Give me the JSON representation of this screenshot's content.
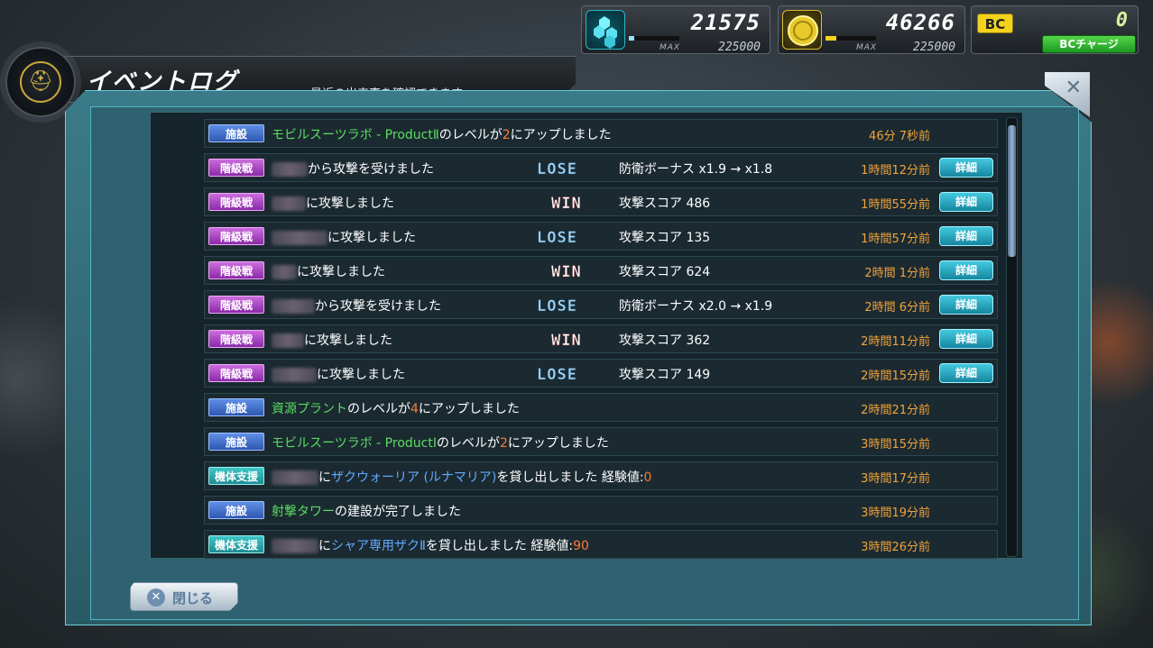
{
  "resources": {
    "parts": {
      "icon": "hex-parts-icon",
      "value": "21575",
      "max_label": "MAX",
      "max": "225000",
      "fill": 0.1
    },
    "coin": {
      "icon": "coin-icon",
      "value": "46266",
      "max_label": "MAX",
      "max": "225000",
      "fill": 0.21
    },
    "bc": {
      "badge": "BC",
      "value": "0",
      "charge_label": "BCチャージ"
    }
  },
  "header": {
    "title": "イベントログ",
    "subtitle": "最近の出来事を確認できます"
  },
  "rows": [
    {
      "cat": "施設",
      "cat_type": "facility",
      "pre": "モビルスーツラボ - ProductⅡ",
      "pre_class": "hl-green",
      "mid": "のレベルが",
      "num": "2",
      "post": "にアップしました",
      "time": "46分 7秒前"
    },
    {
      "cat": "階級戦",
      "cat_type": "rank",
      "blur": 40,
      "text": "から攻撃を受けました",
      "result": "LOSE",
      "bonus": "防衛ボーナス x1.9 → x1.8",
      "time": "1時間12分前",
      "detail": "詳細"
    },
    {
      "cat": "階級戦",
      "cat_type": "rank",
      "blur": 38,
      "text": "に攻撃しました",
      "result": "WIN",
      "bonus": "攻撃スコア 486",
      "time": "1時間55分前",
      "detail": "詳細"
    },
    {
      "cat": "階級戦",
      "cat_type": "rank",
      "blur": 62,
      "text": "に攻撃しました",
      "result": "LOSE",
      "bonus": "攻撃スコア 135",
      "time": "1時間57分前",
      "detail": "詳細"
    },
    {
      "cat": "階級戦",
      "cat_type": "rank",
      "blur": 28,
      "text": "に攻撃しました",
      "result": "WIN",
      "bonus": "攻撃スコア 624",
      "time": "2時間 1分前",
      "detail": "詳細"
    },
    {
      "cat": "階級戦",
      "cat_type": "rank",
      "blur": 48,
      "text": "から攻撃を受けました",
      "result": "LOSE",
      "bonus": "防衛ボーナス x2.0 → x1.9",
      "time": "2時間 6分前",
      "detail": "詳細"
    },
    {
      "cat": "階級戦",
      "cat_type": "rank",
      "blur": 36,
      "text": "に攻撃しました",
      "result": "WIN",
      "bonus": "攻撃スコア 362",
      "time": "2時間11分前",
      "detail": "詳細"
    },
    {
      "cat": "階級戦",
      "cat_type": "rank",
      "blur": 50,
      "text": "に攻撃しました",
      "result": "LOSE",
      "bonus": "攻撃スコア 149",
      "time": "2時間15分前",
      "detail": "詳細"
    },
    {
      "cat": "施設",
      "cat_type": "facility",
      "pre": "資源プラント",
      "pre_class": "hl-green",
      "mid": "のレベルが",
      "num": "4",
      "post": "にアップしました",
      "time": "2時間21分前"
    },
    {
      "cat": "施設",
      "cat_type": "facility",
      "pre": "モビルスーツラボ - ProductⅠ",
      "pre_class": "hl-green",
      "mid": "のレベルが",
      "num": "2",
      "post": "にアップしました",
      "time": "3時間15分前"
    },
    {
      "cat": "機体支援",
      "cat_type": "support",
      "blur": 52,
      "mid": "に",
      "unit": "ザクウォーリア (ルナマリア)",
      "post": "を貸し出しました 経験値:",
      "exp": "0",
      "time": "3時間17分前"
    },
    {
      "cat": "施設",
      "cat_type": "facility",
      "pre": "射撃タワー",
      "pre_class": "hl-green",
      "mid": "の建設が完了しました",
      "time": "3時間19分前"
    },
    {
      "cat": "機体支援",
      "cat_type": "support",
      "blur": 52,
      "mid": "に",
      "unit": "シャア専用ザクⅡ",
      "post": "を貸し出しました 経験値:",
      "exp": "90",
      "time": "3時間26分前"
    }
  ],
  "footer": {
    "close_label": "閉じる"
  },
  "colors": {
    "accent": "#4fb7c6",
    "time": "#f2a33a",
    "highlight_green": "#5bdc62",
    "highlight_orange": "#ff7a3a",
    "highlight_blue": "#62aaff"
  }
}
